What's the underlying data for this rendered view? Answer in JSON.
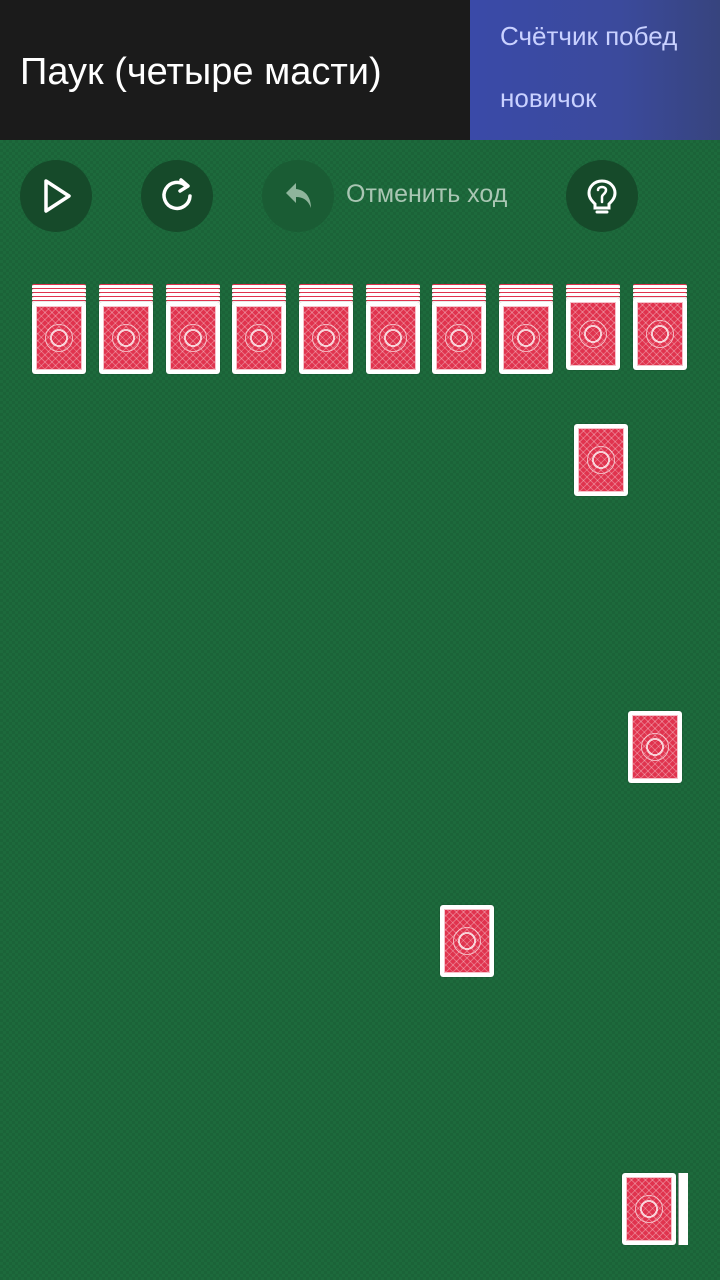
{
  "header": {
    "title": "Паук (четыре масти)",
    "wins_label": "Счётчик побед",
    "rank": "новичок"
  },
  "toolbar": {
    "play_icon": "play-icon",
    "restart_icon": "restart-icon",
    "undo_icon": "undo-icon",
    "undo_label": "Отменить ход",
    "undo_enabled": false,
    "hint_icon": "lightbulb-icon"
  },
  "game": {
    "tableau_columns": 10,
    "face_down_per_column": [
      6,
      6,
      6,
      6,
      6,
      6,
      6,
      6,
      5,
      5
    ],
    "stock_piles_remaining": 5,
    "card_back_color": "#e0334e",
    "felt_color": "#1d6a3c"
  }
}
